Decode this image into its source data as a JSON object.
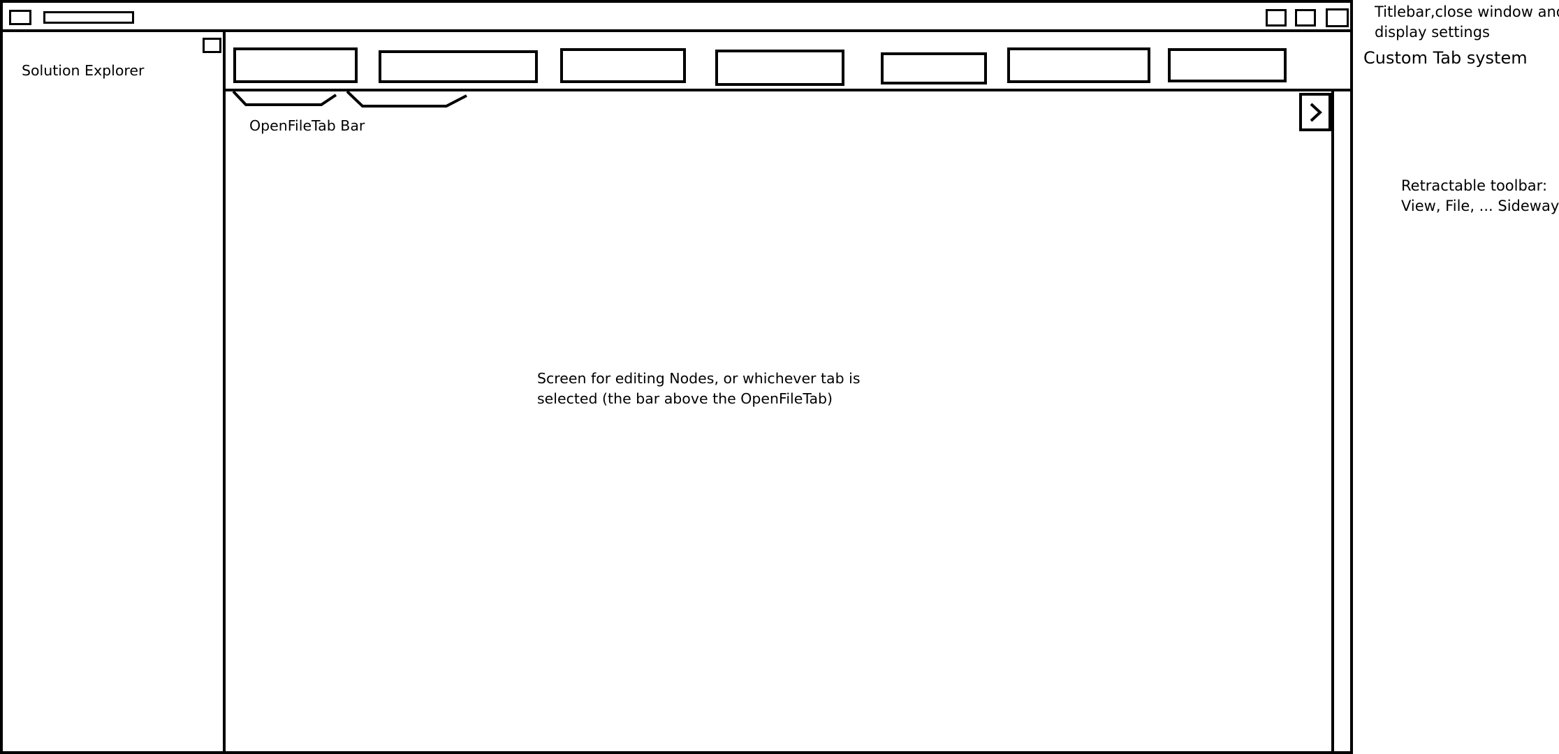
{
  "solution_explorer": {
    "label": "Solution Explorer"
  },
  "open_file_tab_bar": {
    "label": "OpenFileTab Bar"
  },
  "editor": {
    "line1": "Screen for editing Nodes, or whichever tab is",
    "line2": "selected (the bar above the OpenFileTab)"
  },
  "annotations": {
    "titlebar_line1": "Titlebar,close window and",
    "titlebar_line2": "display settings",
    "tab_system": "Custom Tab system",
    "toolbar_line1": "Retractable toolbar:",
    "toolbar_line2": "View, File, ... Sideways"
  },
  "toolbar_toggle": {
    "icon": "chevron-right-icon"
  },
  "colors": {
    "stroke": "#000000",
    "background": "#ffffff"
  }
}
